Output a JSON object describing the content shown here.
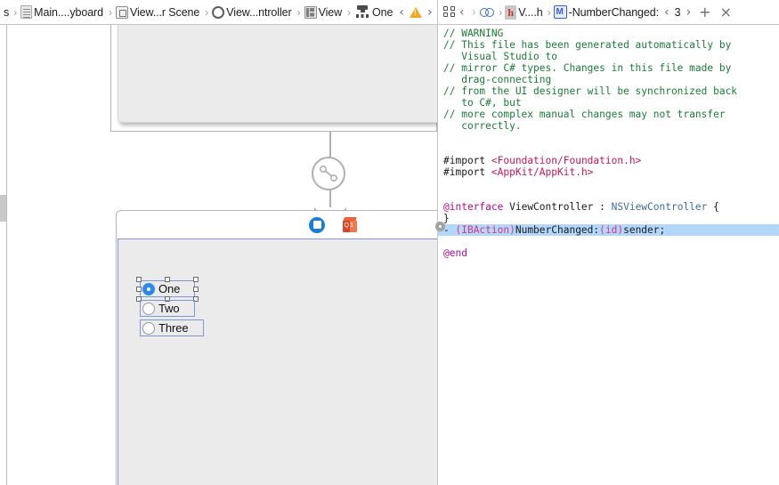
{
  "left_pane": {
    "jumpbar": {
      "leading_label": "s",
      "crumbs": [
        {
          "icon": "document-icon",
          "label": "Main....yboard"
        },
        {
          "icon": "scene-icon",
          "label": "View...r Scene"
        },
        {
          "icon": "view-controller-icon",
          "label": "View...ntroller"
        },
        {
          "icon": "view-icon",
          "label": "View"
        },
        {
          "icon": "radio-matrix-icon",
          "label": "One"
        }
      ],
      "separator": "›",
      "prev_label": "‹",
      "next_label": "›",
      "warning_icon": "warning-triangle-icon"
    },
    "canvas": {
      "scene_titlebar_icons": [
        {
          "name": "placeholder-view-controller-icon"
        },
        {
          "name": "first-responder-icon",
          "badge": "1",
          "glyph": "Q"
        }
      ],
      "connector": {
        "name": "connection-link-icon"
      },
      "radio_group": {
        "options": [
          {
            "label": "One",
            "selected": true
          },
          {
            "label": "Two",
            "selected": false
          },
          {
            "label": "Three",
            "selected": false
          }
        ]
      }
    }
  },
  "right_pane": {
    "assistant_bar": {
      "grid_icon": "grid-view-icon",
      "back_label": "‹",
      "forward_label": "›",
      "related_icon": "related-items-icon",
      "separator": "›",
      "file_icon": "header-file-icon",
      "file_label": "V....h",
      "method_icon": "method-icon",
      "method_label": "-NumberChanged:",
      "counter_prev": "‹",
      "counter_value": "3",
      "counter_next": "›",
      "add_label": "+",
      "close_label": "×"
    },
    "editor": {
      "lines": [
        {
          "text": "// WARNING",
          "cls": "cm"
        },
        {
          "text": "// This file has been generated automatically by",
          "cls": "cm"
        },
        {
          "text": "   Visual Studio to",
          "cls": "cm"
        },
        {
          "text": "// mirror C# types. Changes in this file made by",
          "cls": "cm"
        },
        {
          "text": "   drag-connecting",
          "cls": "cm"
        },
        {
          "text": "// from the UI designer will be synchronized back",
          "cls": "cm"
        },
        {
          "text": "   to C#, but",
          "cls": "cm"
        },
        {
          "text": "// more complex manual changes may not transfer",
          "cls": "cm"
        },
        {
          "text": "   correctly.",
          "cls": "cm"
        },
        {
          "text": "",
          "cls": ""
        },
        {
          "text": "",
          "cls": ""
        },
        {
          "text": "#import <Foundation/Foundation.h>",
          "cls": "mixed-import1"
        },
        {
          "text": "#import <AppKit/AppKit.h>",
          "cls": "mixed-import2"
        },
        {
          "text": "",
          "cls": ""
        },
        {
          "text": "",
          "cls": ""
        },
        {
          "text": "@interface ViewController : NSViewController {",
          "cls": "mixed-iface"
        },
        {
          "text": "}",
          "cls": ""
        },
        {
          "text": "- (IBAction)NumberChanged:(id)sender;",
          "cls": "mixed-action",
          "highlighted": true
        },
        {
          "text": "",
          "cls": ""
        },
        {
          "text": "@end",
          "cls": "kw"
        }
      ],
      "tokens": {
        "import_kw": "#import",
        "foundation_path": "<Foundation/Foundation.h>",
        "appkit_path": "<AppKit/AppKit.h>",
        "interface_kw": "@interface",
        "class_name": "ViewController",
        "colon": " : ",
        "super_name": "NSViewController",
        "open_brace": " {",
        "close_brace": "}",
        "minus": "- ",
        "ibaction": "(IBAction)",
        "method_name": "NumberChanged:",
        "id_type": "(id)",
        "sender": "sender;",
        "end_kw": "@end"
      }
    }
  },
  "colors": {
    "comment_green": "#1d7a37",
    "keyword_magenta": "#aa0d91",
    "string_pink": "#c2185b",
    "type_blue": "#3f6e9e",
    "highlight_blue": "#b3d7fa",
    "selection_blue": "#2e8ae6",
    "border_blue": "#7d97d8",
    "canvas_gray": "#ebebeb"
  }
}
